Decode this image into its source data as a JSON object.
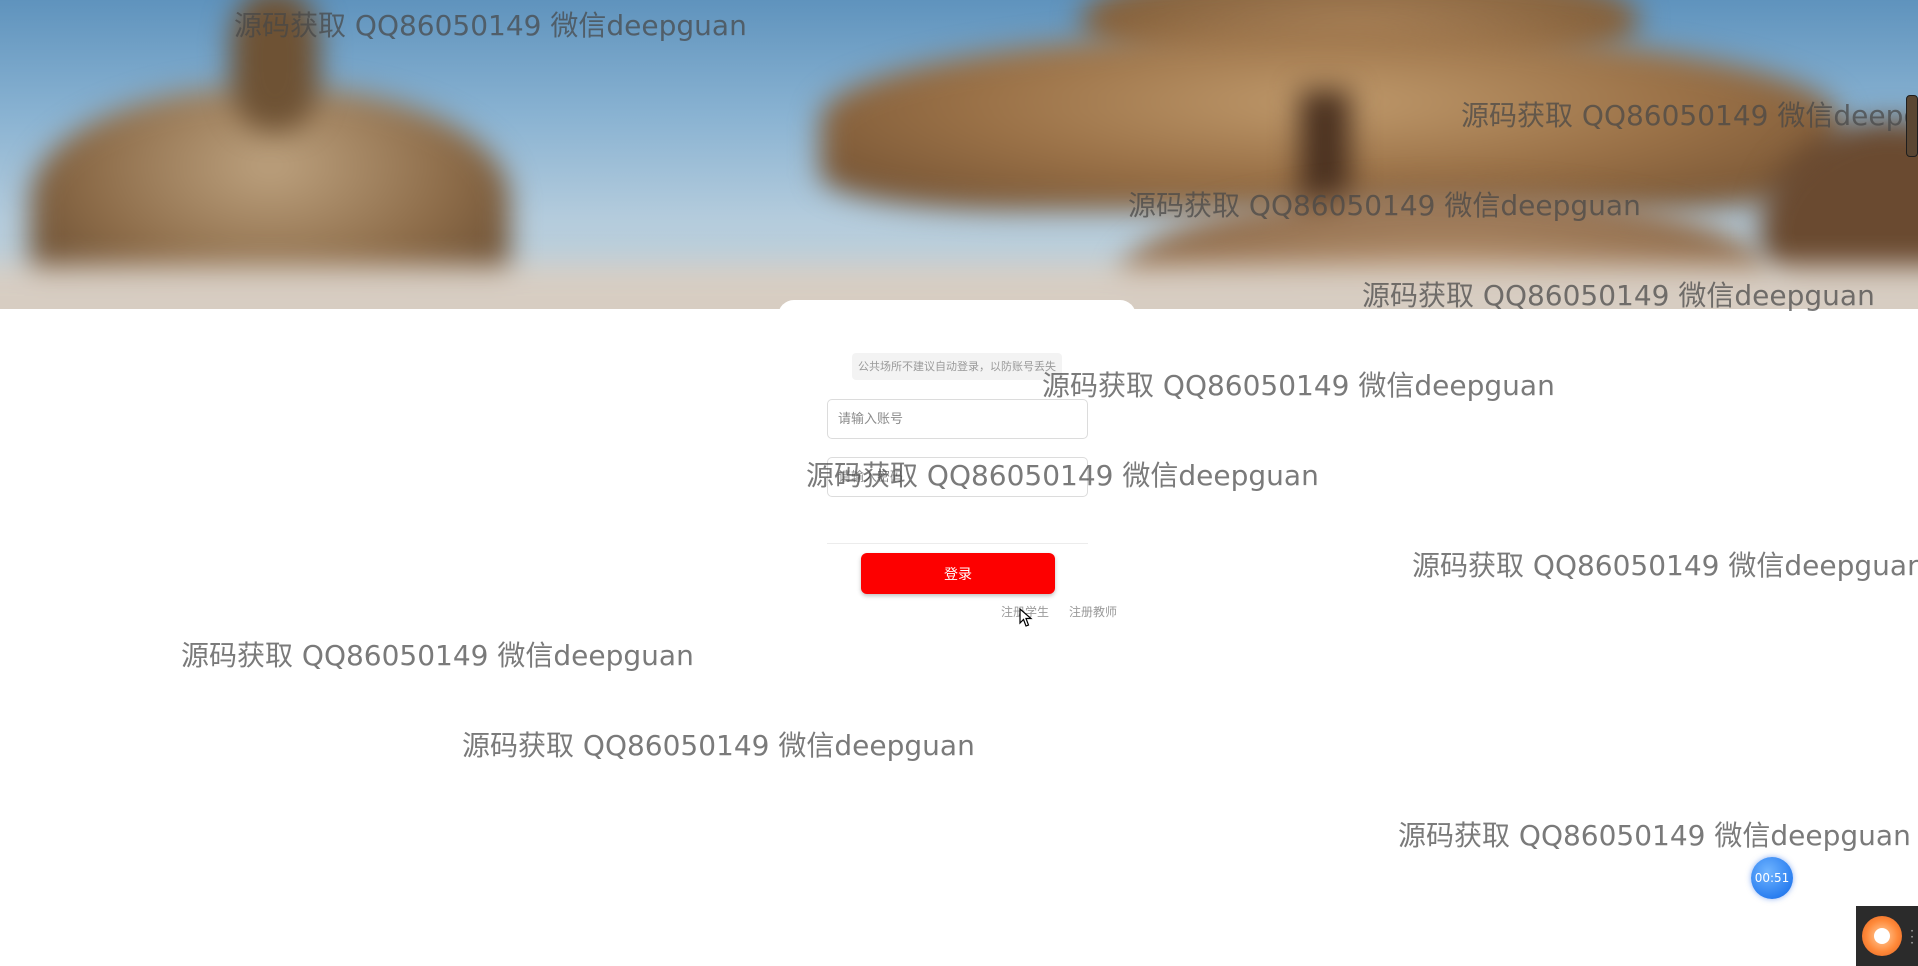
{
  "login": {
    "notice": "公共场所不建议自动登录，以防账号丢失",
    "username_placeholder": "请输入账号",
    "password_placeholder": "请输入密码",
    "login_button": "登录",
    "register_student": "注册学生",
    "register_teacher": "注册教师"
  },
  "watermark": {
    "text": "源码获取 QQ86050149 微信deepguan"
  },
  "timer": {
    "value": "00:51"
  },
  "colors": {
    "login_button": "#fd0000",
    "timer_badge": "#2b7ff0",
    "watermark": "#464646"
  },
  "icons": {
    "app_icon": "gear-icon",
    "cursor": "mouse-cursor-icon"
  }
}
